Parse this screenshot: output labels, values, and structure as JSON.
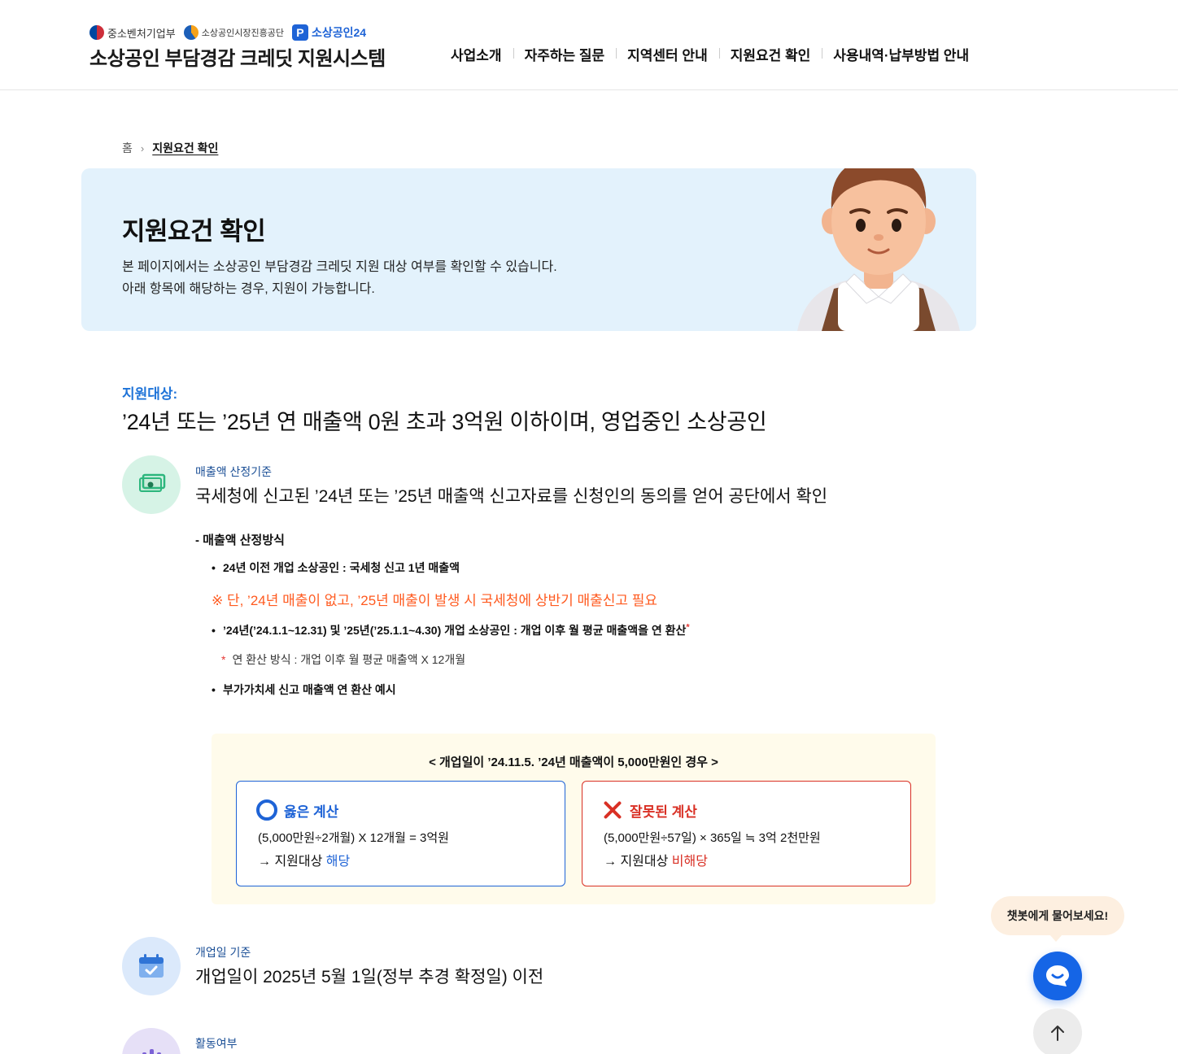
{
  "header": {
    "logo_mss": "중소벤처기업부",
    "logo_semas": "소상공인시장진흥공단",
    "logo_sbiz24": "소상공인24",
    "site_title": "소상공인 부담경감 크레딧 지원시스템",
    "nav": [
      "사업소개",
      "자주하는 질문",
      "지역센터 안내",
      "지원요건 확인",
      "사용내역·납부방법 안내"
    ]
  },
  "breadcrumb": {
    "home": "홈",
    "current": "지원요건 확인"
  },
  "banner": {
    "title": "지원요건 확인",
    "desc_line1": "본 페이지에서는 소상공인 부담경감 크레딧 지원 대상 여부를 확인할 수 있습니다.",
    "desc_line2": "아래 항목에 해당하는 경우, 지원이 가능합니다."
  },
  "target": {
    "label": "지원대상:",
    "text": "’24년 또는 ’25년 연 매출액 0원 초과 3억원 이하이며, 영업중인 소상공인"
  },
  "criteria": [
    {
      "sub": "매출액 산정기준",
      "main": "국세청에 신고된 ’24년 또는 ’25년 매출액 신고자료를 신청인의 동의를 얻어 공단에서 확인",
      "icon": "money-icon"
    },
    {
      "sub": "개업일 기준",
      "main": "개업일이 2025년 5월 1일(정부 추경 확정일) 이전",
      "icon": "calendar-icon"
    },
    {
      "sub": "활동여부",
      "main": "",
      "icon": "activity-icon"
    }
  ],
  "method": {
    "title": "- 매출액 산정방식",
    "bullet1": "24년 이전 개업 소상공인 : 국세청 신고 1년 매출액",
    "red_note": "※ 단, ’24년 매출이 없고, ’25년 매출이 발생 시 국세청에 상반기 매출신고 필요",
    "bullet2": "’24년(’24.1.1~12.31) 및 ’25년(’25.1.1~4.30) 개업 소상공인 : 개업 이후 월 평균 매출액을 연 환산",
    "bullet2_sup": "*",
    "star_mark": "*",
    "star_note": "연 환산 방식 : 개업 이후 월 평균 매출액 X 12개월",
    "bullet3": "부가가치세 신고 매출액 연 환산 예시",
    "bullet_dot": "•"
  },
  "example": {
    "caption": "< 개업일이 ’24.11.5. ’24년 매출액이 5,000만원인 경우 >",
    "right": {
      "title": "옳은 계산",
      "formula": "(5,000만원÷2개월) X 12개월 = 3억원",
      "result_prefix": "→ 지원대상 ",
      "result_value": "해당"
    },
    "wrong": {
      "title": "잘못된 계산",
      "formula": "(5,000만원÷57일) × 365일 ≒ 3억 2천만원",
      "result_prefix": "→ 지원대상 ",
      "result_value": "비해당"
    }
  },
  "floating": {
    "chat_bubble": "챗봇에게 물어보세요!"
  },
  "colors": {
    "accent": "#1e63d6",
    "error": "#d93025",
    "warning": "#ff5a1f",
    "banner_bg": "#e3f2fc"
  }
}
